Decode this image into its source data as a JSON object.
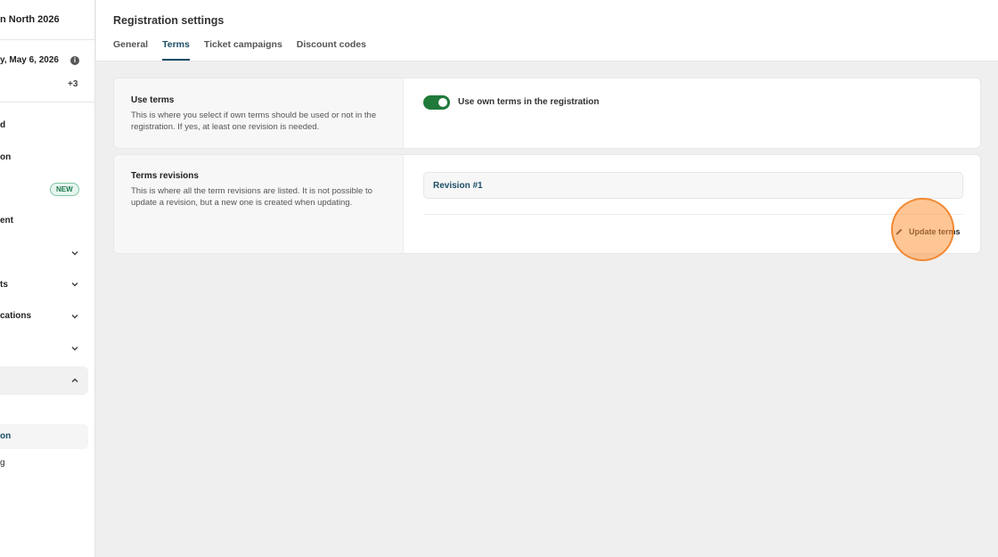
{
  "sidebar": {
    "event_name": "n North 2026",
    "event_date": "y, May 6, 2026",
    "more_count": "+3",
    "items": [
      {
        "label": "d"
      },
      {
        "label": "on"
      },
      {
        "label": "",
        "badge": "NEW"
      },
      {
        "label": "ent"
      },
      {
        "label": ""
      },
      {
        "label": "ts"
      },
      {
        "label": "cations"
      },
      {
        "label": ""
      },
      {
        "label": ""
      }
    ],
    "sub_items": [
      {
        "label": "on"
      },
      {
        "label": "g"
      }
    ]
  },
  "header": {
    "title": "Registration settings",
    "tabs": [
      {
        "label": "General"
      },
      {
        "label": "Terms"
      },
      {
        "label": "Ticket campaigns"
      },
      {
        "label": "Discount codes"
      }
    ]
  },
  "use_terms": {
    "title": "Use terms",
    "description": "This is where you select if own terms should be used or not in the registration. If yes, at least one revision is needed.",
    "toggle_label": "Use own terms in the registration",
    "enabled": true
  },
  "terms_revisions": {
    "title": "Terms revisions",
    "description": "This is where all the term revisions are listed. It is not possible to update a revision, but a new one is created when updating.",
    "revisions": [
      {
        "label": "Revision #1"
      }
    ],
    "update_label": "Update terms"
  },
  "colors": {
    "accent": "#1b4e66",
    "toggle_on": "#1f7a3a",
    "click_marker": "#ff983e"
  }
}
